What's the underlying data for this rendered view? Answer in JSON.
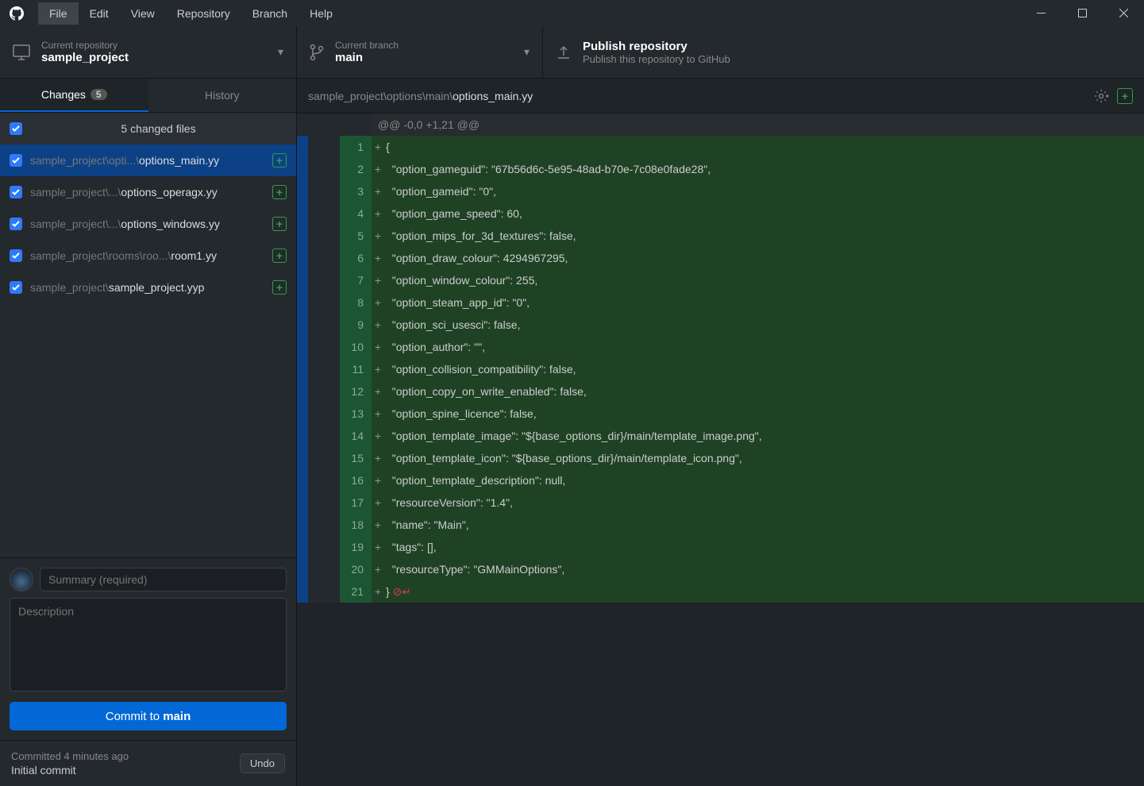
{
  "menu": [
    "File",
    "Edit",
    "View",
    "Repository",
    "Branch",
    "Help"
  ],
  "activeMenu": 0,
  "header": {
    "repo": {
      "label": "Current repository",
      "value": "sample_project"
    },
    "branch": {
      "label": "Current branch",
      "value": "main"
    },
    "publish": {
      "title": "Publish repository",
      "sub": "Publish this repository to GitHub"
    }
  },
  "tabs": {
    "changes": "Changes",
    "changesBadge": "5",
    "history": "History"
  },
  "filesHeader": "5 changed files",
  "files": [
    {
      "dim": "sample_project\\opti...\\",
      "bright": "options_main.yy",
      "selected": true
    },
    {
      "dim": "sample_project\\...\\",
      "bright": "options_operagx.yy",
      "selected": false
    },
    {
      "dim": "sample_project\\...\\",
      "bright": "options_windows.yy",
      "selected": false
    },
    {
      "dim": "sample_project\\rooms\\roo...\\",
      "bright": "room1.yy",
      "selected": false
    },
    {
      "dim": "sample_project\\",
      "bright": "sample_project.yyp",
      "selected": false
    }
  ],
  "summaryPlaceholder": "Summary (required)",
  "descPlaceholder": "Description",
  "commitPrefix": "Commit to ",
  "commitBranch": "main",
  "lastCommit": {
    "time": "Committed 4 minutes ago",
    "msg": "Initial commit",
    "undo": "Undo"
  },
  "pathDim": "sample_project\\options\\main\\",
  "pathBright": "options_main.yy",
  "hunkHeader": "@@ -0,0 +1,21 @@",
  "diffLines": [
    "{",
    "  \"option_gameguid\": \"67b56d6c-5e95-48ad-b70e-7c08e0fade28\",",
    "  \"option_gameid\": \"0\",",
    "  \"option_game_speed\": 60,",
    "  \"option_mips_for_3d_textures\": false,",
    "  \"option_draw_colour\": 4294967295,",
    "  \"option_window_colour\": 255,",
    "  \"option_steam_app_id\": \"0\",",
    "  \"option_sci_usesci\": false,",
    "  \"option_author\": \"\",",
    "  \"option_collision_compatibility\": false,",
    "  \"option_copy_on_write_enabled\": false,",
    "  \"option_spine_licence\": false,",
    "  \"option_template_image\": \"${base_options_dir}/main/template_image.png\",",
    "  \"option_template_icon\": \"${base_options_dir}/main/template_icon.png\",",
    "  \"option_template_description\": null,",
    "  \"resourceVersion\": \"1.4\",",
    "  \"name\": \"Main\",",
    "  \"tags\": [],",
    "  \"resourceType\": \"GMMainOptions\",",
    "}"
  ]
}
